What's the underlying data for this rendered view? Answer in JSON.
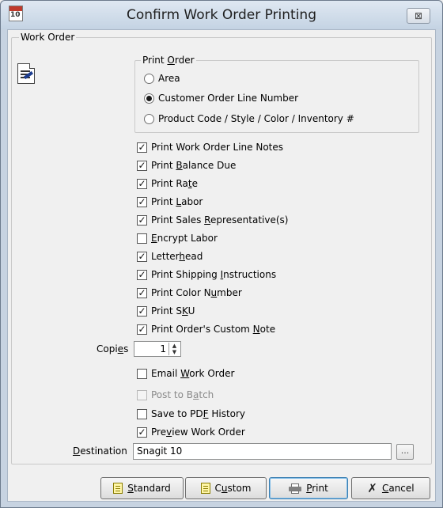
{
  "window": {
    "title": "Confirm Work Order Printing",
    "app_icon_text": "10",
    "close_glyph": "⊠"
  },
  "work_order_group": {
    "legend": "Work Order",
    "icon": "work-order-document-icon"
  },
  "print_order": {
    "legend_pre": "Print ",
    "legend_acc": "O",
    "legend_post": "rder",
    "options": [
      {
        "label": "Area",
        "selected": false
      },
      {
        "label": "Customer Order Line Number",
        "selected": true
      },
      {
        "label": "Product Code / Style / Color / Inventory #",
        "selected": false
      }
    ]
  },
  "checkboxes": [
    {
      "pre": "Print Work Order Line Notes",
      "acc": "",
      "post": "",
      "checked": true
    },
    {
      "pre": "Print ",
      "acc": "B",
      "post": "alance Due",
      "checked": true
    },
    {
      "pre": "Print Ra",
      "acc": "t",
      "post": "e",
      "checked": true
    },
    {
      "pre": "Print ",
      "acc": "L",
      "post": "abor",
      "checked": true
    },
    {
      "pre": "Print Sales ",
      "acc": "R",
      "post": "epresentative(s)",
      "checked": true
    },
    {
      "pre": "",
      "acc": "E",
      "post": "ncrypt Labor",
      "checked": false
    },
    {
      "pre": "Letter",
      "acc": "h",
      "post": "ead",
      "checked": true
    },
    {
      "pre": "Print Shipping ",
      "acc": "I",
      "post": "nstructions",
      "checked": true
    },
    {
      "pre": "Print Color N",
      "acc": "u",
      "post": "mber",
      "checked": true
    },
    {
      "pre": "Print S",
      "acc": "K",
      "post": "U",
      "checked": true
    },
    {
      "pre": "Print Order's Custom ",
      "acc": "N",
      "post": "ote",
      "checked": true
    }
  ],
  "copies": {
    "label_pre": "Copi",
    "label_acc": "e",
    "label_post": "s",
    "value": "1"
  },
  "output_options": [
    {
      "pre": "Email ",
      "acc": "W",
      "post": "ork Order",
      "checked": false,
      "disabled": false
    },
    {
      "pre": "Post to B",
      "acc": "a",
      "post": "tch",
      "checked": false,
      "disabled": true
    },
    {
      "pre": "Save to PD",
      "acc": "F",
      "post": " History",
      "checked": false,
      "disabled": false
    },
    {
      "pre": "Pre",
      "acc": "v",
      "post": "iew Work Order",
      "checked": true,
      "disabled": false
    }
  ],
  "destination": {
    "label_pre": "",
    "label_acc": "D",
    "label_post": "estination",
    "value": "Snagit 10",
    "browse_label": "..."
  },
  "buttons": {
    "standard": {
      "pre": "",
      "acc": "S",
      "post": "tandard"
    },
    "custom": {
      "pre": "C",
      "acc": "u",
      "post": "stom"
    },
    "print": {
      "pre": "",
      "acc": "P",
      "post": "rint"
    },
    "cancel": {
      "pre": "",
      "acc": "C",
      "post": "ancel"
    }
  }
}
